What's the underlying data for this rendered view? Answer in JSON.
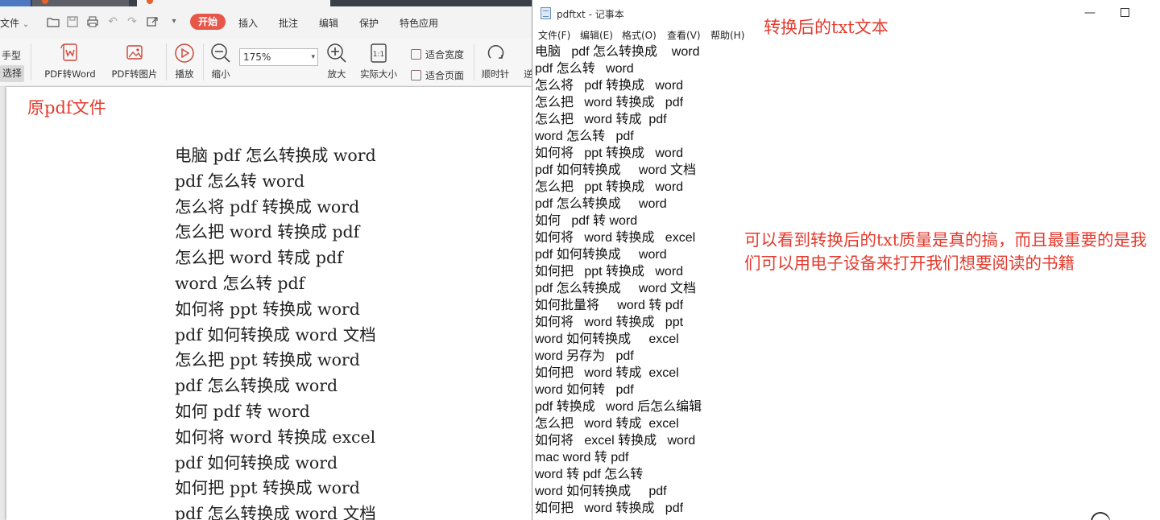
{
  "pdf_app": {
    "menu": {
      "file": "文件",
      "start": "开始",
      "items": [
        "插入",
        "批注",
        "编辑",
        "保护",
        "特色应用"
      ]
    },
    "toolbar": {
      "hand": "手型",
      "select": "选择",
      "pdf_to_word": "PDF转Word",
      "pdf_to_image": "PDF转图片",
      "play": "播放",
      "zoom_out": "缩小",
      "zoom_value": "175%",
      "zoom_in": "放大",
      "actual_size": "实际大小",
      "fit_width": "适合宽度",
      "fit_page": "适合页面",
      "rotate_cw": "顺时针",
      "rotate_ccw": "逆"
    },
    "annotation": "原pdf文件",
    "lines": [
      "电脑 pdf 怎么转换成 word",
      "pdf 怎么转 word",
      "怎么将 pdf 转换成 word",
      "怎么把 word 转换成 pdf",
      "怎么把 word 转成 pdf",
      "word 怎么转 pdf",
      "如何将 ppt 转换成 word",
      "pdf 如何转换成 word 文档",
      "怎么把 ppt 转换成 word",
      "pdf 怎么转换成 word",
      "如何 pdf 转 word",
      "如何将 word 转换成 excel",
      "pdf 如何转换成 word",
      "如何把 ppt 转换成 word",
      "pdf 怎么转换成 word 文档"
    ]
  },
  "notepad": {
    "title": "pdftxt - 记事本",
    "menu": [
      "文件(F)",
      "编辑(E)",
      "格式(O)",
      "查看(V)",
      "帮助(H)"
    ],
    "lines": [
      "电脑   pdf 怎么转换成    word",
      "pdf 怎么转   word",
      "怎么将   pdf 转换成   word",
      "怎么把   word 转换成   pdf",
      "怎么把   word 转成  pdf",
      "word 怎么转   pdf",
      "如何将   ppt 转换成   word",
      "pdf 如何转换成     word 文档",
      "怎么把   ppt 转换成   word",
      "pdf 怎么转换成     word",
      "如何   pdf 转 word",
      "如何将   word 转换成   excel",
      "pdf 如何转换成     word",
      "如何把   ppt 转换成   word",
      "pdf 怎么转换成     word 文档",
      "如何批量将     word 转 pdf",
      "如何将   word 转换成   ppt",
      "word 如何转换成     excel",
      "word 另存为   pdf",
      "如何把   word 转成  excel",
      "word 如何转   pdf",
      "pdf 转换成   word 后怎么编辑",
      "怎么把   word 转成  excel",
      "如何将   excel 转换成   word",
      "mac word 转 pdf",
      "word 转 pdf 怎么转",
      "word 如何转换成     pdf",
      "如何把   word 转换成   pdf"
    ]
  },
  "annotations": {
    "converted_txt": "转换后的txt文本",
    "comment": "可以看到转换后的txt质量是真的搞，而且最重要的是我们可以用电子设备来打开我们想要阅读的书籍"
  },
  "colors": {
    "annotation_red": "#e33b2e",
    "start_tab": "#e8564a"
  }
}
